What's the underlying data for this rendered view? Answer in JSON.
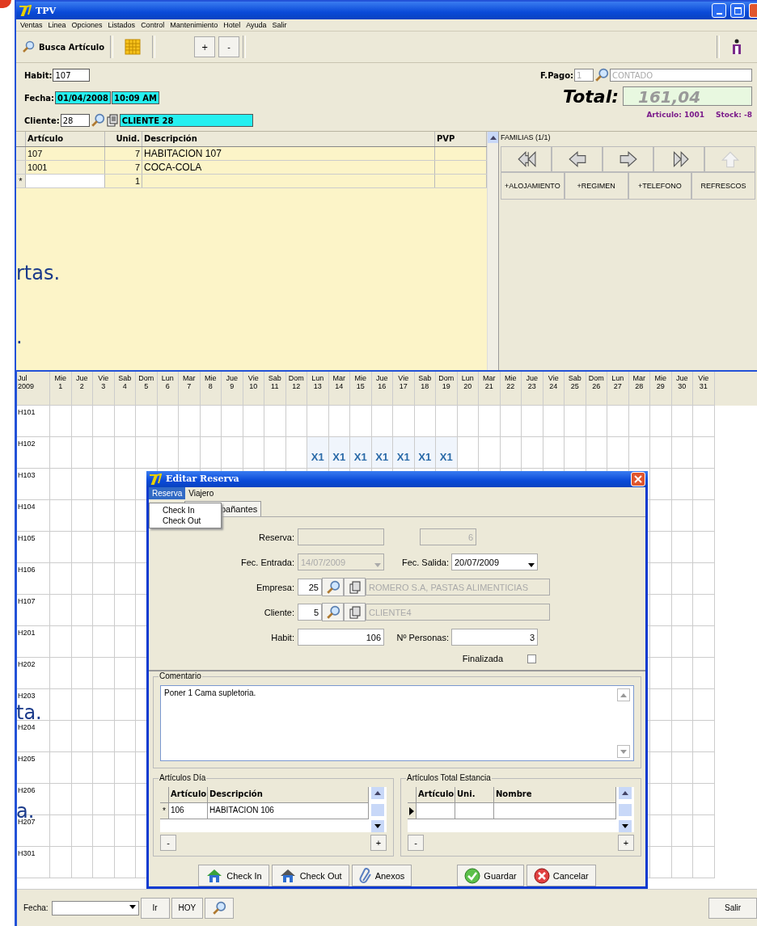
{
  "slide_text": [
    "rtas.",
    ".",
    "ta.",
    "a."
  ],
  "tpv_window": {
    "title": "TPV",
    "menu": [
      "Ventas",
      "Linea",
      "Opciones",
      "Listados",
      "Control",
      "Mantenimiento",
      "Hotel",
      "Ayuda",
      "Salir"
    ],
    "toolbar": {
      "search_button": "Busca Artículo",
      "plus": "+",
      "minus": "-"
    },
    "form": {
      "habit_label": "Habit:",
      "habit": "107",
      "fecha_label": "Fecha:",
      "fecha": "01/04/2008",
      "hora": "10:09 AM",
      "cliente_label": "Cliente:",
      "cliente": "28",
      "cliente_nombre": "CLIENTE 28",
      "pago_label": "F.Pago:",
      "pago": "1",
      "pago_nombre": "CONTADO",
      "total_label": "Total:",
      "total": "161,04",
      "articulo_info": "Articulo: 1001",
      "stock_info": "Stock: -8"
    },
    "lines_table": {
      "columns": [
        "Artículo",
        "Unid.",
        "Descripción",
        "PVP"
      ],
      "rows": [
        {
          "articulo": "107",
          "unid": "7",
          "descripcion": "HABITACION 107",
          "editing": false
        },
        {
          "articulo": "1001",
          "unid": "7",
          "descripcion": "COCA-COLA",
          "editing": false
        },
        {
          "marker": "*",
          "unid": "1",
          "editing": true
        }
      ]
    },
    "families": {
      "title": "FAMILIAS (1/1)",
      "nav": [
        {
          "kind": "first",
          "disabled": false
        },
        {
          "kind": "prev",
          "disabled": false
        },
        {
          "kind": "next",
          "disabled": false
        },
        {
          "kind": "last",
          "disabled": false
        },
        {
          "kind": "up",
          "disabled": true
        }
      ],
      "buttons": [
        "+ALOJAMIENTO",
        "+REGIMEN",
        "+TELEFONO",
        "REFRESCOS"
      ]
    }
  },
  "calendar": {
    "month": "Jul",
    "year": "2009",
    "days": [
      {
        "weekday": "Mie",
        "day": "1"
      },
      {
        "weekday": "Jue",
        "day": "2"
      },
      {
        "weekday": "Vie",
        "day": "3"
      },
      {
        "weekday": "Sab",
        "day": "4"
      },
      {
        "weekday": "Dom",
        "day": "5"
      },
      {
        "weekday": "Lun",
        "day": "6"
      },
      {
        "weekday": "Mar",
        "day": "7"
      },
      {
        "weekday": "Mie",
        "day": "8"
      },
      {
        "weekday": "Jue",
        "day": "9"
      },
      {
        "weekday": "Vie",
        "day": "10"
      },
      {
        "weekday": "Sab",
        "day": "11"
      },
      {
        "weekday": "Dom",
        "day": "12"
      },
      {
        "weekday": "Lun",
        "day": "13"
      },
      {
        "weekday": "Mar",
        "day": "14"
      },
      {
        "weekday": "Mie",
        "day": "15"
      },
      {
        "weekday": "Jue",
        "day": "16"
      },
      {
        "weekday": "Vie",
        "day": "17"
      },
      {
        "weekday": "Sab",
        "day": "18"
      },
      {
        "weekday": "Dom",
        "day": "19"
      },
      {
        "weekday": "Lun",
        "day": "20"
      },
      {
        "weekday": "Mar",
        "day": "21"
      },
      {
        "weekday": "Mie",
        "day": "22"
      },
      {
        "weekday": "Jue",
        "day": "23"
      },
      {
        "weekday": "Vie",
        "day": "24"
      },
      {
        "weekday": "Sab",
        "day": "25"
      },
      {
        "weekday": "Dom",
        "day": "26"
      },
      {
        "weekday": "Lun",
        "day": "27"
      },
      {
        "weekday": "Mar",
        "day": "28"
      },
      {
        "weekday": "Mie",
        "day": "29"
      },
      {
        "weekday": "Jue",
        "day": "30"
      },
      {
        "weekday": "Vie",
        "day": "31"
      }
    ],
    "rows": [
      {
        "label": "H101"
      },
      {
        "label": "H102",
        "cells": [
          {
            "booked": false
          },
          {
            "booked": false
          },
          {
            "booked": false
          },
          {
            "booked": false
          },
          {
            "booked": false
          },
          {
            "booked": false
          },
          {
            "booked": false
          },
          {
            "booked": false
          },
          {
            "booked": false
          },
          {
            "booked": false
          },
          {
            "booked": false
          },
          {
            "booked": false
          },
          {
            "booked": true,
            "text": "X1"
          },
          {
            "booked": true,
            "text": "X1"
          },
          {
            "booked": true,
            "text": "X1"
          },
          {
            "booked": true,
            "text": "X1"
          },
          {
            "booked": true,
            "text": "X1"
          },
          {
            "booked": true,
            "text": "X1"
          },
          {
            "booked": true,
            "text": "X1"
          },
          {
            "booked": false
          },
          {
            "booked": false
          },
          {
            "booked": false
          },
          {
            "booked": false
          },
          {
            "booked": false
          },
          {
            "booked": false
          },
          {
            "booked": false
          },
          {
            "booked": false
          },
          {
            "booked": false
          },
          {
            "booked": false
          },
          {
            "booked": false
          },
          {
            "booked": false
          }
        ]
      },
      {
        "label": "H103"
      },
      {
        "label": "H104"
      },
      {
        "label": "H105"
      },
      {
        "label": "H106"
      },
      {
        "label": "H107"
      },
      {
        "label": "H201"
      },
      {
        "label": "H202"
      },
      {
        "label": "H203"
      },
      {
        "label": "H204"
      },
      {
        "label": "H205"
      },
      {
        "label": "H206"
      },
      {
        "label": "H207"
      },
      {
        "label": "H301"
      }
    ],
    "footer": {
      "fecha_label": "Fecha:",
      "ir": "Ir",
      "hoy": "HOY",
      "salir": "Salir"
    }
  },
  "dialog": {
    "title": "Editar Reserva",
    "menu": [
      {
        "label": "Reserva",
        "selected": true
      },
      {
        "label": "Viajero",
        "selected": false
      }
    ],
    "dropdown": [
      "Check In",
      "Check Out"
    ],
    "tab": "pañantes",
    "reserva_label": "Reserva:",
    "reserva_number": "6",
    "entrada_label": "Fec. Entrada:",
    "entrada": "14/07/2009",
    "salida_label": "Fec. Salida:",
    "salida": "20/07/2009",
    "empresa_label": "Empresa:",
    "empresa": "25",
    "empresa_nombre": "ROMERO S.A, PASTAS ALIMENTICIAS",
    "cliente_label": "Cliente:",
    "cliente": "5",
    "cliente_nombre": "CLIENTE4",
    "habit_label": "Habit:",
    "habit": "106",
    "personas_label": "Nº Personas:",
    "personas": "3",
    "finalizada_label": "Finalizada",
    "finalizada": false,
    "comentario_label": "Comentario",
    "comentario": "Poner 1 Cama supletoria.",
    "articulos_dia": {
      "title": "Artículos Día",
      "columns": [
        "Artículo",
        "Descripción"
      ],
      "rows": [
        {
          "marker": "*",
          "current": false,
          "cells": [
            "106",
            "HABITACION 106"
          ]
        }
      ],
      "minus": "-",
      "plus": "+"
    },
    "articulos_total": {
      "title": "Artículos Total Estancia",
      "columns": [
        "Artículo",
        "Uni.",
        "Nombre"
      ],
      "rows": [
        {
          "current": true
        }
      ],
      "minus": "-",
      "plus": "+"
    },
    "buttons": [
      {
        "kind": "checkin",
        "label": "Check In"
      },
      {
        "kind": "checkout",
        "label": "Check Out"
      },
      {
        "kind": "anexos",
        "label": "Anexos"
      },
      {
        "kind": "guardar",
        "label": "Guardar"
      },
      {
        "kind": "cancelar",
        "label": "Cancelar"
      }
    ]
  }
}
